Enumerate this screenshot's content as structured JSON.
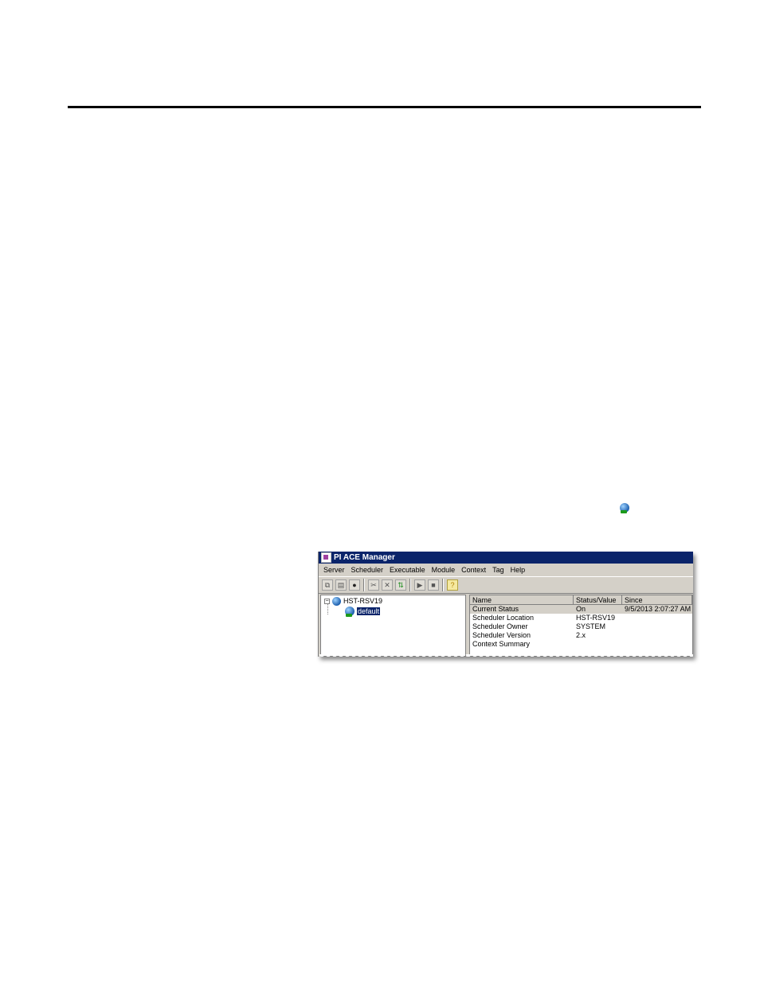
{
  "window": {
    "title": "PI ACE Manager"
  },
  "menu": [
    "Server",
    "Scheduler",
    "Executable",
    "Module",
    "Context",
    "Tag",
    "Help"
  ],
  "toolbar": {
    "icons": [
      "copy-icon",
      "paste-icon",
      "find-icon",
      "cut-icon",
      "delete-icon",
      "refresh-icon",
      "start-icon",
      "stop-icon",
      "help-icon"
    ]
  },
  "tree": {
    "server": "HST-RSV19",
    "scheduler": "default"
  },
  "list": {
    "columns": [
      "Name",
      "Status/Value",
      "Since"
    ],
    "rows": [
      {
        "name": "Current Status",
        "value": "On",
        "since": "9/5/2013 2:07:27 AM"
      },
      {
        "name": "Scheduler Location",
        "value": "HST-RSV19",
        "since": ""
      },
      {
        "name": "Scheduler Owner",
        "value": "SYSTEM",
        "since": ""
      },
      {
        "name": "Scheduler Version",
        "value": "2.x",
        "since": ""
      },
      {
        "name": "Context Summary",
        "value": "",
        "since": ""
      }
    ]
  },
  "colors": {
    "titlebar": "#0a246a",
    "selection": "#0a246a",
    "chrome": "#d4d0c8"
  }
}
